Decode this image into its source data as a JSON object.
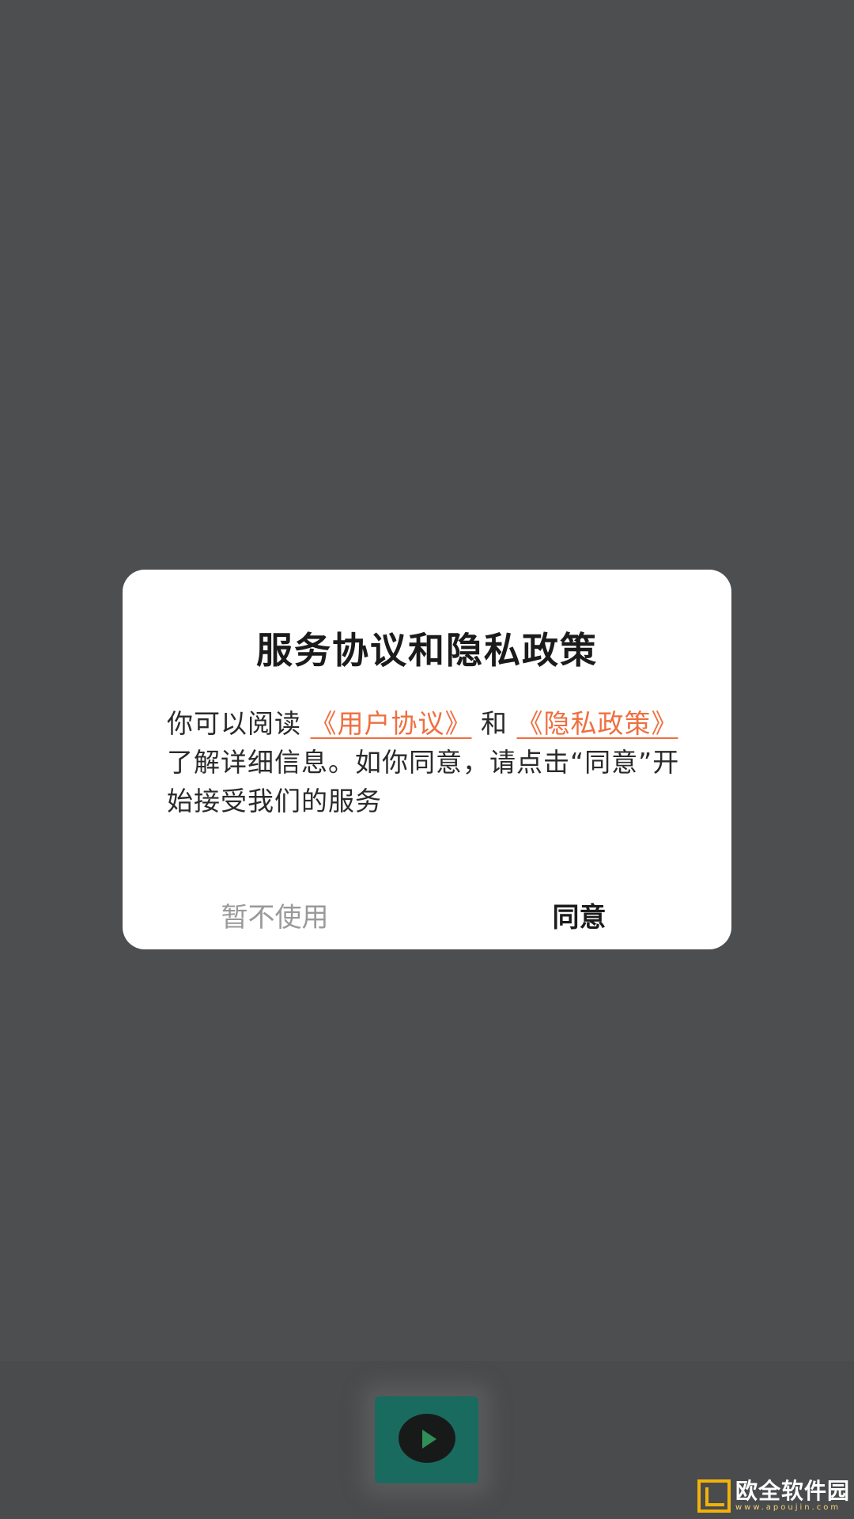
{
  "dialog": {
    "title": "服务协议和隐私政策",
    "body": {
      "text_1": "你可以阅读 ",
      "link_user_agreement": "《用户协议》",
      "text_2": " 和 ",
      "link_privacy_policy": "《隐私政策》",
      "text_3": " 了解详细信息。如你同意，请点击“同意”开始接受我们的服务"
    },
    "buttons": {
      "decline_label": "暂不使用",
      "agree_label": "同意"
    }
  },
  "splash": {
    "icon": "play-icon"
  },
  "watermark": {
    "name": "欧全软件园",
    "url": "www.apoujin.com"
  },
  "colors": {
    "link": "#ef6f3f",
    "overlay": "#4d4e4f",
    "dialog_bg": "#ffffff",
    "decline_text": "#9a9a9a",
    "watermark_accent": "#f2b20a"
  }
}
